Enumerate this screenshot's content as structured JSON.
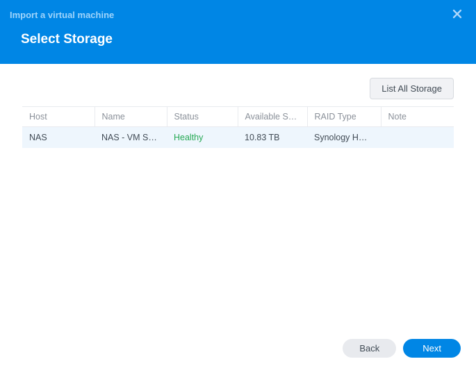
{
  "dialog": {
    "title": "Import a virtual machine",
    "heading": "Select Storage"
  },
  "toolbar": {
    "list_all_label": "List All Storage"
  },
  "table": {
    "headers": {
      "host": "Host",
      "name": "Name",
      "status": "Status",
      "available": "Available S…",
      "raid": "RAID Type",
      "note": "Note"
    },
    "rows": [
      {
        "host": "NAS",
        "name": "NAS - VM S…",
        "status": "Healthy",
        "available": "10.83 TB",
        "raid": "Synology H…",
        "note": ""
      }
    ]
  },
  "footer": {
    "back_label": "Back",
    "next_label": "Next"
  }
}
